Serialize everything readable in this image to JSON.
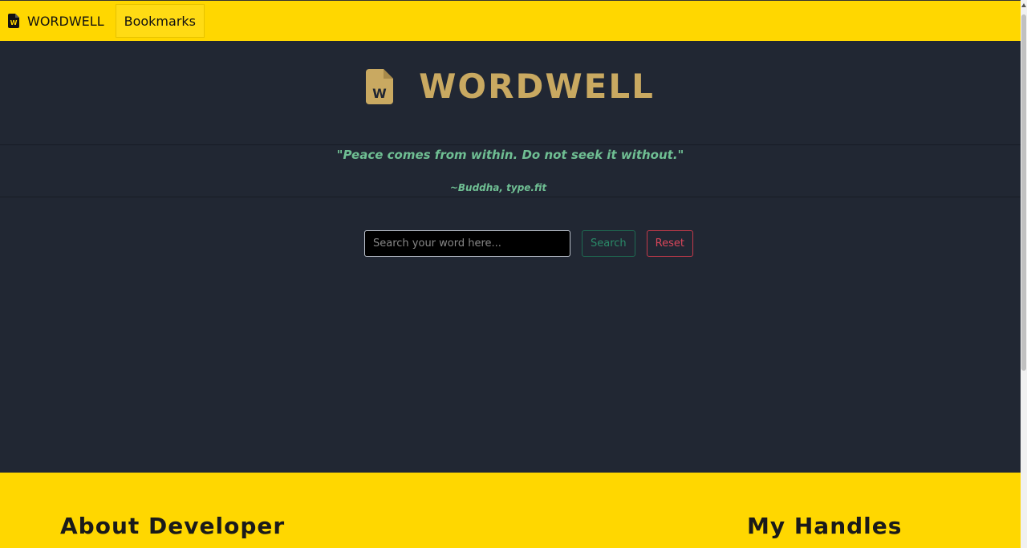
{
  "navbar": {
    "brand": "WORDWELL",
    "bookmarks": "Bookmarks",
    "brand_icon": "file-word-icon"
  },
  "hero": {
    "title": "WORDWELL",
    "icon": "file-word-icon",
    "icon_letter": "W"
  },
  "quote": {
    "text": "\"Peace comes from within. Do not seek it without.\"",
    "author": "~Buddha, type.fit"
  },
  "search": {
    "placeholder": "Search your word here...",
    "search_label": "Search",
    "reset_label": "Reset"
  },
  "footer": {
    "about_heading": "About Developer",
    "handles_heading": "My Handles"
  },
  "colors": {
    "navbar_bg": "#ffd700",
    "page_bg": "#212733",
    "title_gold": "#c9a961",
    "quote_green": "#6fbf93",
    "search_green": "#2a8a68",
    "reset_red": "#d9465a"
  }
}
